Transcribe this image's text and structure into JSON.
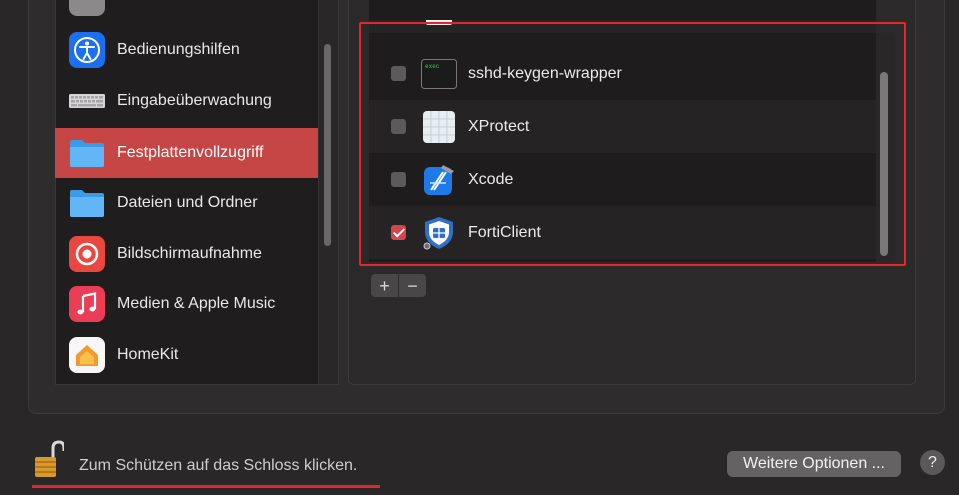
{
  "sidebar": {
    "items": [
      {
        "label": "Bedienungshilfen",
        "icon": "accessibility-icon",
        "selected": false
      },
      {
        "label": "Eingabeüberwachung",
        "icon": "keyboard-icon",
        "selected": false
      },
      {
        "label": "Festplattenvollzugriff",
        "icon": "folder-icon",
        "selected": true
      },
      {
        "label": "Dateien und Ordner",
        "icon": "folder-icon",
        "selected": false
      },
      {
        "label": "Bildschirmaufnahme",
        "icon": "screen-record-icon",
        "selected": false
      },
      {
        "label": "Medien & Apple Music",
        "icon": "music-icon",
        "selected": false
      },
      {
        "label": "HomeKit",
        "icon": "home-icon",
        "selected": false
      }
    ]
  },
  "app_list": {
    "apps": [
      {
        "name": "sshd-keygen-wrapper",
        "checked": false,
        "icon": "terminal-icon",
        "icon_text": "exec"
      },
      {
        "name": "XProtect",
        "checked": false,
        "icon": "xprotect-icon"
      },
      {
        "name": "Xcode",
        "checked": false,
        "icon": "xcode-icon"
      },
      {
        "name": "FortiClient",
        "checked": true,
        "icon": "forticlient-shield-icon"
      }
    ],
    "add_label": "+",
    "remove_label": "−"
  },
  "footer": {
    "lock_text": "Zum Schützen auf das Schloss klicken.",
    "more_options_label": "Weitere Optionen ...",
    "help_label": "?"
  },
  "colors": {
    "selection": "#c64545",
    "highlight": "#e4262b",
    "checkbox_checked": "#d7444b"
  }
}
